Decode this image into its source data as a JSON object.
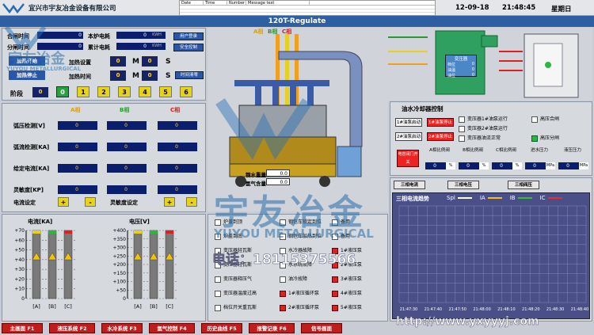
{
  "header": {
    "company": "宜兴市宇友冶金设备有限公司",
    "log_columns": [
      "Date",
      "Time",
      "Number",
      "Message text"
    ],
    "date": "12-09-18",
    "time": "21:48:45",
    "weekday": "星期日",
    "title": "120T-Regulate"
  },
  "energy": {
    "rows": [
      {
        "label": "合闸时间",
        "value": "0",
        "unit": "",
        "side_label": "本炉电耗",
        "side_value": "0",
        "side_unit": "KWH"
      },
      {
        "label": "分闸时间",
        "value": "0",
        "unit": "",
        "side_label": "累计电耗",
        "side_value": "0",
        "side_unit": "KWH"
      }
    ],
    "btn_user": "用户登录",
    "btn_security": "安全控制",
    "heat_start": "加热开始",
    "heat_stop": "加热停止",
    "heat_setting": "加热设置",
    "heat_time": "加热时间",
    "heat_setting_m": "0",
    "heat_setting_s": "0",
    "m_label": "M",
    "s_label": "S",
    "heat_time_m": "0",
    "heat_time_s": "0",
    "time_reset": "时间清零",
    "stage_label": "阶段",
    "stage_current": "0",
    "stages": [
      "0",
      "1",
      "2",
      "3",
      "4",
      "5",
      "6",
      "7"
    ]
  },
  "phases": {
    "headers": [
      "A相",
      "B相",
      "C相"
    ],
    "rows": [
      {
        "label": "弧压检测[V]",
        "values": [
          "0",
          "0",
          "0"
        ]
      },
      {
        "label": "弧流检测[KA]",
        "values": [
          "0",
          "0",
          "0"
        ]
      },
      {
        "label": "给定电流[KA]",
        "values": [
          "0",
          "0",
          "0"
        ]
      },
      {
        "label": "灵敏度[KP]",
        "values": [
          "0",
          "0",
          "0"
        ]
      }
    ],
    "current_set": "电流设定",
    "sens_set": "灵敏度设定",
    "plus": "+",
    "minus": "-"
  },
  "bars": {
    "current_title": "电流[KA]",
    "voltage_title": "电压[V]",
    "current_ticks": [
      "+70",
      "+60",
      "+50",
      "+40",
      "+30",
      "+20",
      "+10",
      "0"
    ],
    "voltage_ticks": [
      "+400",
      "+350",
      "+300",
      "+250",
      "+200",
      "+150",
      "+100",
      "+50",
      "0"
    ],
    "labels": [
      "[A]",
      "[B]",
      "[C]"
    ]
  },
  "furnace": {
    "phase_labels": [
      "A相",
      "B相",
      "C相"
    ],
    "steel_weight_label": "钢水重量",
    "steel_weight": "0.0",
    "argon_label": "氩气含量",
    "argon": "0.0",
    "transformer_title": "变压器",
    "tx_rows": [
      {
        "label": "档位",
        "value": "0"
      },
      {
        "label": "油温",
        "value": "0"
      },
      {
        "label": "油位",
        "value": "0"
      }
    ]
  },
  "cooling": {
    "title": "油水冷却器控制",
    "pump1_start": "1#油泵启动",
    "pump1_stop": "1#油泵停止",
    "pump2_start": "2#油泵启动",
    "pump2_stop": "2#油泵停止",
    "status": [
      {
        "text": "变压器1#油泵运行",
        "state": "off"
      },
      {
        "text": "变压器2#油泵运行",
        "state": "off"
      },
      {
        "text": "变压器油流正常",
        "state": "off"
      },
      {
        "text": "高压合闸",
        "state": "off"
      },
      {
        "text": "高压分闸",
        "state": "on"
      }
    ],
    "valve_btn": "电容阀门开关",
    "valve_cols": [
      {
        "label": "A相比例阀",
        "value": "0",
        "unit": "%"
      },
      {
        "label": "B相比例阀",
        "value": "0",
        "unit": "%"
      },
      {
        "label": "C相比例阀",
        "value": "0",
        "unit": "%"
      },
      {
        "label": "进水压力",
        "value": "0",
        "unit": "MPa"
      },
      {
        "label": "液压压力",
        "value": "0",
        "unit": "MPa"
      }
    ]
  },
  "alarms": {
    "items": [
      {
        "text": "炉盖到顶",
        "state": "off"
      },
      {
        "text": "钢包车锁定到位",
        "state": "off"
      },
      {
        "text": "备用",
        "state": "off"
      },
      {
        "text": "炉盖到底",
        "state": "off"
      },
      {
        "text": "钢包车加热到位",
        "state": "off"
      },
      {
        "text": "备用",
        "state": "off"
      },
      {
        "text": "变压器轻瓦斯",
        "state": "off"
      },
      {
        "text": "水冷器故障",
        "state": "off"
      },
      {
        "text": "1#液压泵",
        "state": "on"
      },
      {
        "text": "变压器轻瓦斯",
        "state": "off"
      },
      {
        "text": "水系统故障",
        "state": "off"
      },
      {
        "text": "2#液压泵",
        "state": "on"
      },
      {
        "text": "变压器释压气",
        "state": "off"
      },
      {
        "text": "油冷故障",
        "state": "off"
      },
      {
        "text": "3#液压泵",
        "state": "on"
      },
      {
        "text": "变压器温度过高",
        "state": "off"
      },
      {
        "text": "1#液压循环泵",
        "state": "on"
      },
      {
        "text": "4#液压泵",
        "state": "on"
      },
      {
        "text": "档位开关重瓦斯",
        "state": "off"
      },
      {
        "text": "2#液压循环泵",
        "state": "on"
      },
      {
        "text": "5#液压泵",
        "state": "on"
      }
    ]
  },
  "trend": {
    "tabs": [
      "三相电流",
      "三相电压",
      "三相阀压"
    ],
    "title": "三相电流趋势",
    "legend": [
      {
        "name": "Spl",
        "color": "#ffffff"
      },
      {
        "name": "IA",
        "color": "#f0c020"
      },
      {
        "name": "IB",
        "color": "#30c030"
      },
      {
        "name": "IC",
        "color": "#e03030"
      }
    ],
    "x_ticks": [
      "21:47:30",
      "21:47:40",
      "21:47:50",
      "21:48:00",
      "21:48:10",
      "21:48:20",
      "21:48:30",
      "21:48:40"
    ],
    "bg": "#4a4f88"
  },
  "watermark": {
    "brand": "宇友冶金",
    "brand_en": "YUYOU METALLURGICAL",
    "phone": "电话：18115375566",
    "url": "http://www.yxyyyj.com"
  },
  "nav": [
    "主画面 F1",
    "液压系统 F2",
    "水冷系统 F3",
    "氩气控制 F4",
    "历史曲线 F5",
    "报警记录 F6",
    "信号画面"
  ]
}
